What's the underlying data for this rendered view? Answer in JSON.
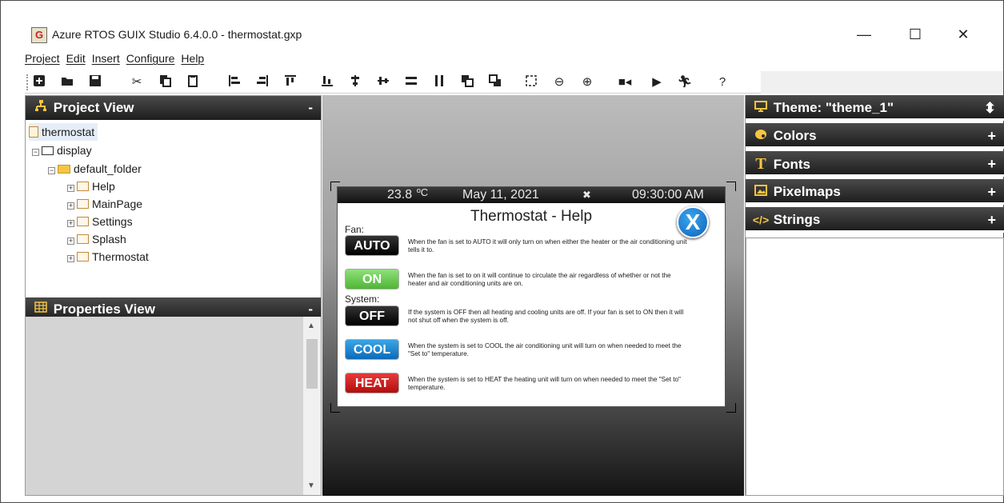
{
  "window": {
    "title": "Azure RTOS GUIX Studio 6.4.0.0 - thermostat.gxp",
    "icon_letters": "G",
    "controls": {
      "minimize": "—",
      "maximize": "☐",
      "close": "✕"
    }
  },
  "menu": [
    "Project",
    "Edit",
    "Insert",
    "Configure",
    "Help"
  ],
  "toolbar": {
    "icons": [
      "new-project-icon",
      "open-icon",
      "save-icon",
      "cut-icon",
      "copy-icon",
      "paste-icon",
      "align-left-icon",
      "align-right-icon",
      "align-top-icon",
      "align-bottom-icon",
      "v-center-icon",
      "h-center-icon",
      "equal-width-icon",
      "equal-height-icon",
      "bring-to-front-icon",
      "send-to-back-icon",
      "size-to-content-icon",
      "zoom-out-icon",
      "zoom-in-icon",
      "record-macro-icon",
      "playback-icon",
      "run-icon",
      "help-icon"
    ]
  },
  "project_view": {
    "title": "Project View",
    "collapse_label": "-",
    "tree": {
      "root": "thermostat",
      "display": "display",
      "folder": "default_folder",
      "screens": [
        "Help",
        "MainPage",
        "Settings",
        "Splash",
        "Thermostat"
      ]
    }
  },
  "properties_view": {
    "title": "Properties View",
    "collapse_label": "-"
  },
  "preview": {
    "status": {
      "temperature": "23.8",
      "unit": "ºC",
      "date": "May 11, 2021",
      "fan_glyph": "✖",
      "time": "09:30:00 AM"
    },
    "title": "Thermostat - Help",
    "close_label": "X",
    "fan_label": "Fan:",
    "system_label": "System:",
    "items": [
      {
        "button": "AUTO",
        "text": "When the fan is set to AUTO it will only turn on when either the heater or the air conditioning unit tells it to."
      },
      {
        "button": "ON",
        "text": "When the fan is set to on it will continue to circulate the air regardless of whether or not the heater and air conditioning units are on."
      },
      {
        "button": "OFF",
        "text": "If the system is OFF then all heating and cooling units are off. If your fan is set to ON then it will not shut off when the system is off."
      },
      {
        "button": "COOL",
        "text": "When the system is set to COOL the air conditioning unit will turn on when needed to meet the \"Set to\" temperature."
      },
      {
        "button": "HEAT",
        "text": "When the system is set to HEAT the heating unit will turn on when needed to meet the \"Set to\" temperature."
      }
    ]
  },
  "resource_panel": {
    "theme": {
      "label": "Theme: \"theme_1\"",
      "icon": "monitor-icon",
      "control": "⬍"
    },
    "sections": [
      {
        "label": "Colors",
        "icon": "palette-icon",
        "control": "+"
      },
      {
        "label": "Fonts",
        "icon": "font-icon",
        "control": "+"
      },
      {
        "label": "Pixelmaps",
        "icon": "image-icon",
        "control": "+"
      },
      {
        "label": "Strings",
        "icon": "code-icon",
        "control": "+"
      }
    ]
  },
  "colors": {
    "panel_header": "#2a2a2a",
    "auto": "#000000",
    "on": "#5bc13e",
    "off": "#000000",
    "cool": "#1a7fd0",
    "heat": "#c41a1a",
    "close_button": "#1a7fd0"
  }
}
